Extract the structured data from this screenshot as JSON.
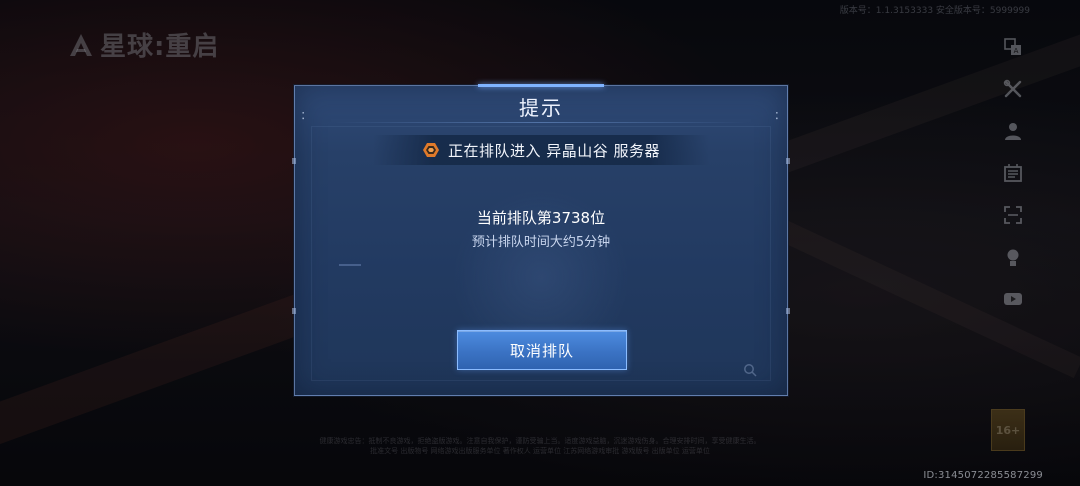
{
  "background": {
    "logo_text": "星球:重启",
    "meta_text": "版本号：1.1.3153333   安全版本号：5999999",
    "age_rating": "16+",
    "legal_lines": [
      "健康游戏忠告：抵制不良游戏，拒绝盗版游戏。注意自我保护，谨防受骗上当。适度游戏益脑，沉迷游戏伤身。合理安排时间，享受健康生活。",
      "批准文号  出版物号  网络游戏出版服务单位  著作权人  运营单位  江苏网络游戏审批  游戏版号  出版单位  运营单位"
    ],
    "user_id": "ID:3145072285587299"
  },
  "toolbar": {
    "icons": [
      "translate-icon",
      "tools-icon",
      "user-icon",
      "notice-icon",
      "scan-icon",
      "headset-icon",
      "video-icon"
    ]
  },
  "dialog": {
    "title": "提示",
    "server_line": "正在排队进入 异晶山谷 服务器",
    "queue_position": "当前排队第3738位",
    "queue_eta": "预计排队时间大约5分钟",
    "cancel_label": "取消排队"
  },
  "colors": {
    "dialog_bg": "#274068",
    "button": "#3b73c4",
    "accent": "#7fb3ff",
    "server_icon": "#e07a2a"
  }
}
